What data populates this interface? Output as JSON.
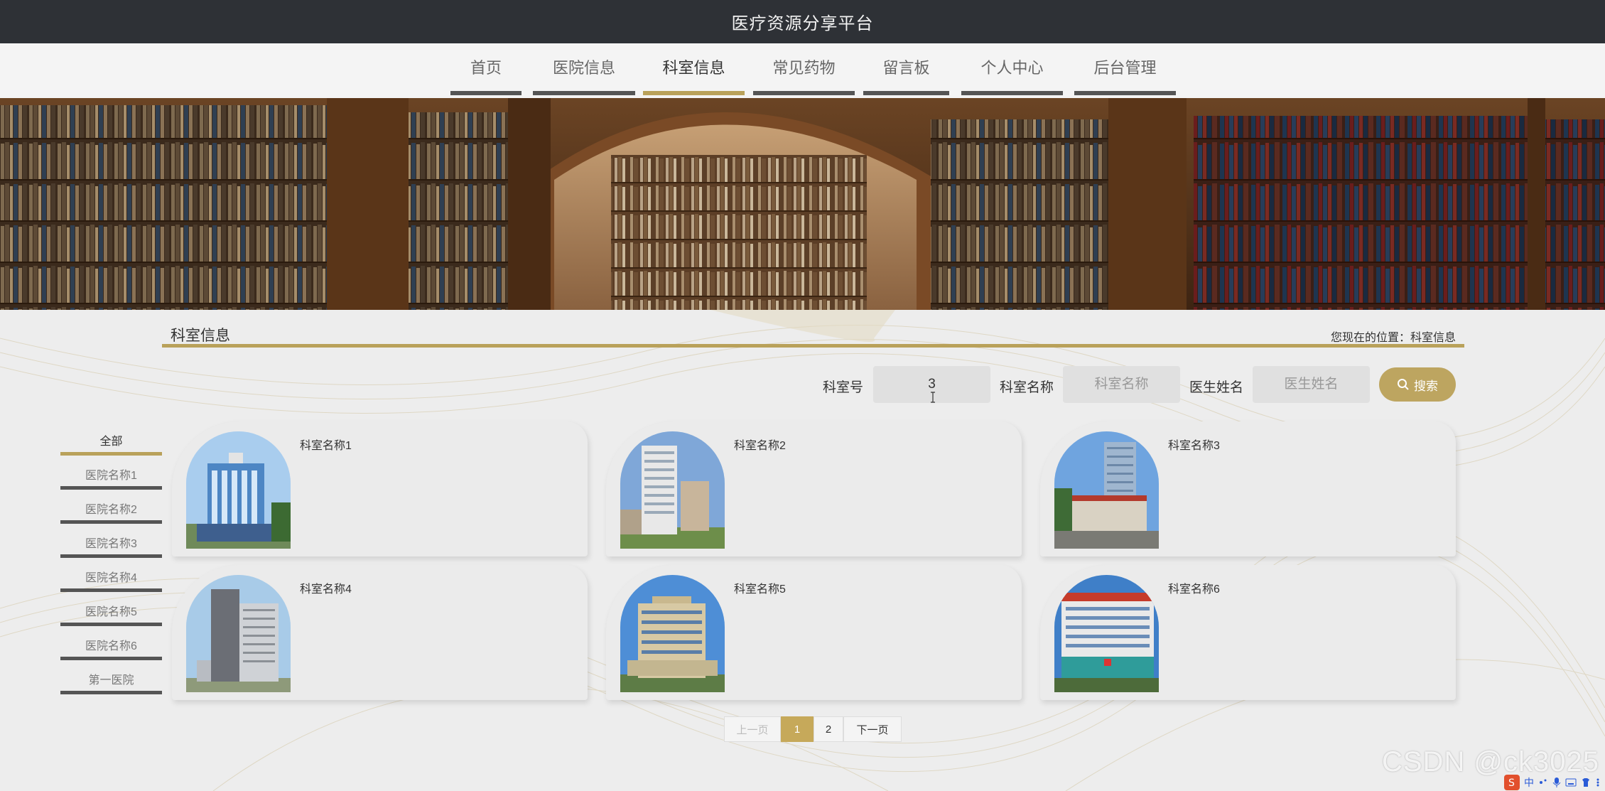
{
  "app": {
    "title": "医疗资源分享平台"
  },
  "nav": {
    "items": [
      {
        "label": "首页"
      },
      {
        "label": "医院信息"
      },
      {
        "label": "科室信息"
      },
      {
        "label": "常见药物"
      },
      {
        "label": "留言板"
      },
      {
        "label": "个人中心"
      },
      {
        "label": "后台管理"
      }
    ],
    "active_index": 2
  },
  "section": {
    "title": "科室信息",
    "breadcrumb": "您现在的位置：科室信息"
  },
  "search": {
    "dept_no_label": "科室号",
    "dept_no_value": "3",
    "dept_name_label": "科室名称",
    "dept_name_placeholder": "科室名称",
    "doctor_label": "医生姓名",
    "doctor_placeholder": "医生姓名",
    "button_label": "搜索",
    "button_icon": "search-icon"
  },
  "categories": [
    {
      "label": "全部",
      "active": true
    },
    {
      "label": "医院名称1"
    },
    {
      "label": "医院名称2"
    },
    {
      "label": "医院名称3"
    },
    {
      "label": "医院名称4"
    },
    {
      "label": "医院名称5"
    },
    {
      "label": "医院名称6"
    },
    {
      "label": "第一医院"
    }
  ],
  "cards": [
    {
      "name": "科室名称1"
    },
    {
      "name": "科室名称2"
    },
    {
      "name": "科室名称3"
    },
    {
      "name": "科室名称4"
    },
    {
      "name": "科室名称5"
    },
    {
      "name": "科室名称6"
    }
  ],
  "pagination": {
    "prev": "上一页",
    "pages": [
      "1",
      "2"
    ],
    "current": "1",
    "next": "下一页"
  },
  "watermark": "CSDN @ck3025",
  "tray": {
    "ime": "中"
  },
  "colors": {
    "accent": "#b9a15a",
    "topbar": "#2e3136",
    "nav_bar": "#555555"
  }
}
